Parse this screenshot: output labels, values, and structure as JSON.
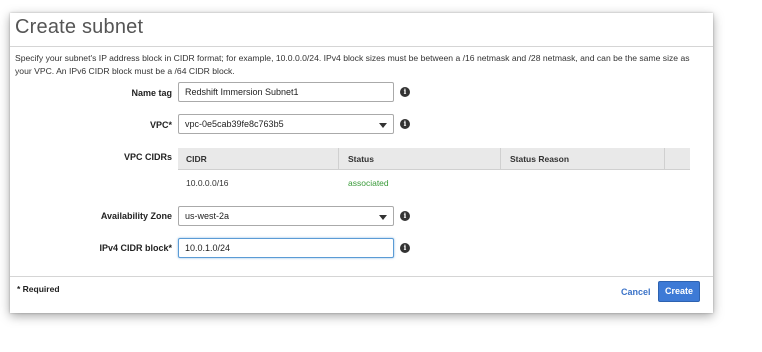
{
  "dialog": {
    "title": "Create subnet",
    "description": "Specify your subnet's IP address block in CIDR format; for example, 10.0.0.0/24. IPv4 block sizes must be between a /16 netmask and /28 netmask, and can be the same size as your VPC. An IPv6 CIDR block must be a /64 CIDR block."
  },
  "form": {
    "name_tag": {
      "label": "Name tag",
      "value": "Redshift Immersion Subnet1"
    },
    "vpc": {
      "label": "VPC*",
      "value": "vpc-0e5cab39fe8c763b5"
    },
    "vpc_cidrs": {
      "label": "VPC CIDRs",
      "columns": [
        "CIDR",
        "Status",
        "Status Reason"
      ],
      "rows": [
        {
          "cidr": "10.0.0.0/16",
          "status": "associated",
          "reason": ""
        }
      ]
    },
    "availability_zone": {
      "label": "Availability Zone",
      "value": "us-west-2a"
    },
    "ipv4_cidr": {
      "label": "IPv4 CIDR block*",
      "value": "10.0.1.0/24"
    }
  },
  "footer": {
    "required_note": "* Required",
    "cancel_label": "Cancel",
    "create_label": "Create"
  },
  "icons": {
    "info": "info-icon",
    "dropdown": "chevron-down-icon"
  },
  "colors": {
    "primary": "#3d7ad6",
    "link": "#3b73c8",
    "status_ok": "#3a9b3a"
  }
}
